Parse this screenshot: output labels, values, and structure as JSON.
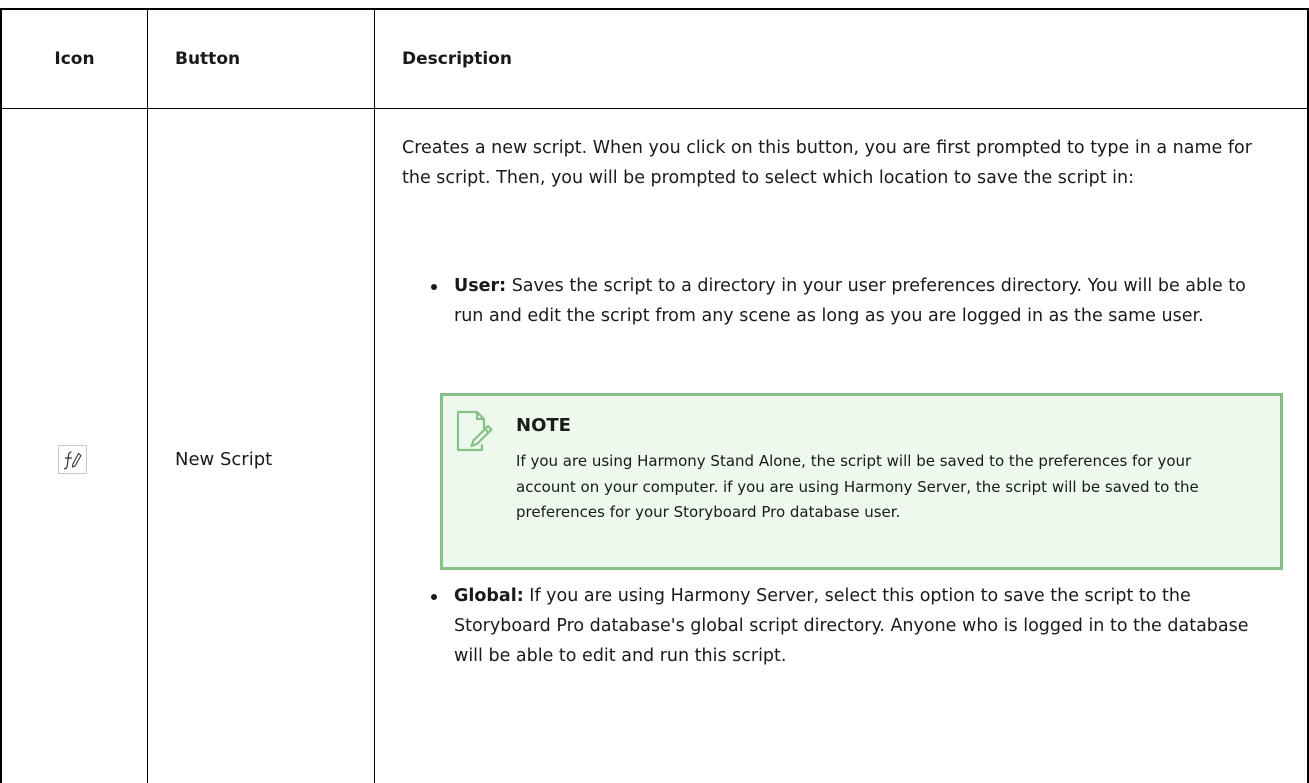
{
  "table": {
    "headers": {
      "icon": "Icon",
      "button": "Button",
      "description": "Description"
    },
    "rows": [
      {
        "icon": "script-new-icon",
        "button": "New Script",
        "intro": "Creates a new script. When you click on this button, you are first prompted to type in a name for the script. Then, you will be prompted to select which location to save the script in:",
        "bullets": [
          {
            "label": "User:",
            "text": "Saves the script to a directory in your user preferences directory. You will be able to run and edit the script from any scene as long as you are logged in as the same user."
          },
          {
            "label": "Global:",
            "text": "If you are using Harmony Server, select this option to save the script to the Storyboard Pro database's global script directory. Anyone who is logged in to the database will be able to edit and run this script."
          }
        ],
        "note": {
          "title": "NOTE",
          "text": "If you are using Harmony Stand Alone, the script will be saved to the preferences for your account on your computer. if you are using Harmony Server, the script will be saved to the preferences for your Storyboard Pro database user."
        }
      }
    ]
  },
  "colors": {
    "border": "#000000",
    "note_background": "#ecf9ec",
    "note_border": "#86c086",
    "note_icon": "#86c086"
  }
}
